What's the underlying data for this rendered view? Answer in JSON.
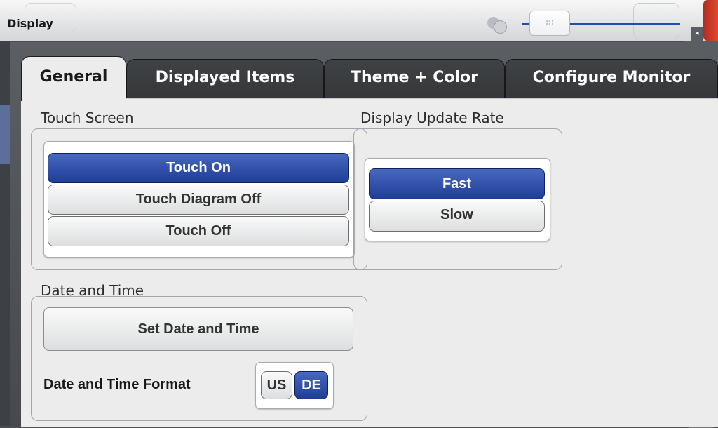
{
  "window": {
    "title": "Display"
  },
  "tabs": [
    {
      "label": "General",
      "active": true
    },
    {
      "label": "Displayed Items",
      "active": false
    },
    {
      "label": "Theme + Color",
      "active": false
    },
    {
      "label": "Configure Monitor",
      "active": false
    }
  ],
  "touch_screen": {
    "label": "Touch Screen",
    "options": [
      "Touch On",
      "Touch Diagram Off",
      "Touch Off"
    ],
    "selected": "Touch On"
  },
  "update_rate": {
    "label": "Display Update Rate",
    "options": [
      "Fast",
      "Slow"
    ],
    "selected": "Fast"
  },
  "date_time": {
    "label": "Date and Time",
    "set_button": "Set Date and Time",
    "format_label": "Date and Time Format",
    "format_options": [
      "US",
      "DE"
    ],
    "format_selected": "DE"
  },
  "colors": {
    "selected_button": "#1f3d96",
    "panel_background": "#ececec",
    "dark_tab": "#3a3c3f",
    "close_button": "#d9432c"
  },
  "icons": [
    "transparency-icon",
    "opacity-slider",
    "close-icon",
    "left-arrow-icon"
  ]
}
